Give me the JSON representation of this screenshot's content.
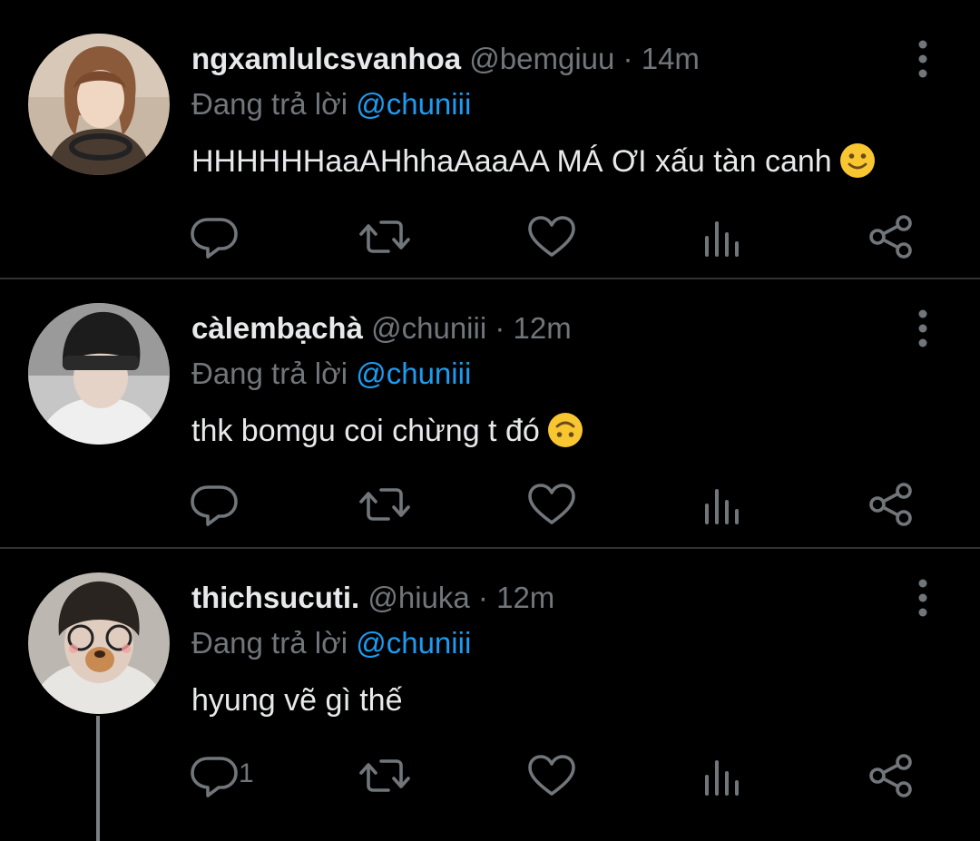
{
  "tweets": [
    {
      "display_name": "ngxamlulcsvanhoa",
      "handle": "@bemgiuu",
      "separator": "·",
      "time": "14m",
      "replying_label": "Đang trả lời",
      "replying_to": "@chuniii",
      "text": "HHHHHHaaAHhhaAaaAA MÁ ƠI xấu tàn canh",
      "emoji": "slightly-smiling-face",
      "reply_count": ""
    },
    {
      "display_name": "càlembạchà",
      "handle": "@chuniii",
      "separator": "·",
      "time": "12m",
      "replying_label": "Đang trả lời",
      "replying_to": "@chuniii",
      "text": "thk bomgu coi chừng t đó",
      "emoji": "upside-down-face",
      "reply_count": ""
    },
    {
      "display_name": "thichsucuti.",
      "handle": "@hiuka",
      "separator": "·",
      "time": "12m",
      "replying_label": "Đang trả lời",
      "replying_to": "@chuniii",
      "text": "hyung vẽ gì thế",
      "emoji": "",
      "reply_count": "1"
    }
  ],
  "colors": {
    "background": "#000000",
    "text": "#e7e9ea",
    "muted": "#71767b",
    "link": "#1d9bf0",
    "divider": "#2f3336"
  },
  "icons": [
    "reply-icon",
    "retweet-icon",
    "like-icon",
    "views-icon",
    "share-icon",
    "more-icon"
  ]
}
